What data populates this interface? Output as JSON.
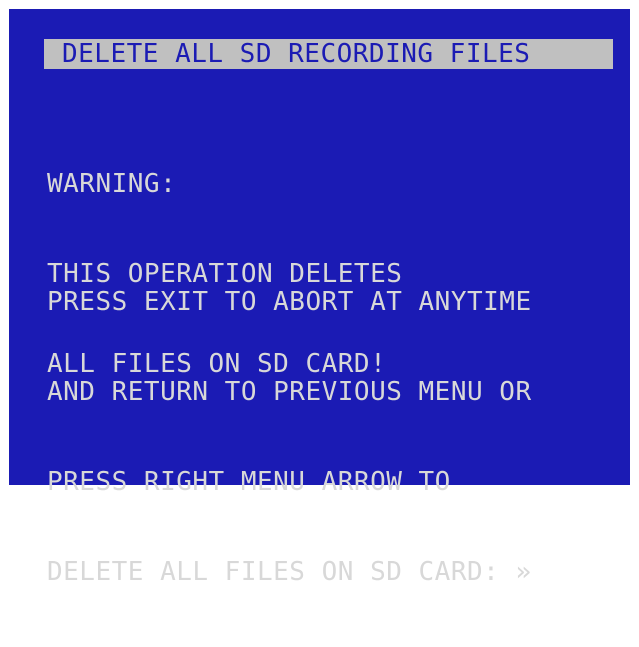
{
  "menu": {
    "title": "DELETE ALL SD RECORDING FILES"
  },
  "warning": {
    "lines": [
      "WARNING:",
      "THIS OPERATION DELETES",
      "ALL FILES ON SD CARD!"
    ]
  },
  "instructions": {
    "lines": [
      "PRESS EXIT TO ABORT AT ANYTIME",
      "AND RETURN TO PREVIOUS MENU OR",
      "PRESS RIGHT MENU ARROW TO",
      "DELETE ALL FILES ON SD CARD: »"
    ]
  },
  "colors": {
    "background": "#1b1bb4",
    "text": "#d8d8d8",
    "title_bar": "#c0c0c0"
  }
}
